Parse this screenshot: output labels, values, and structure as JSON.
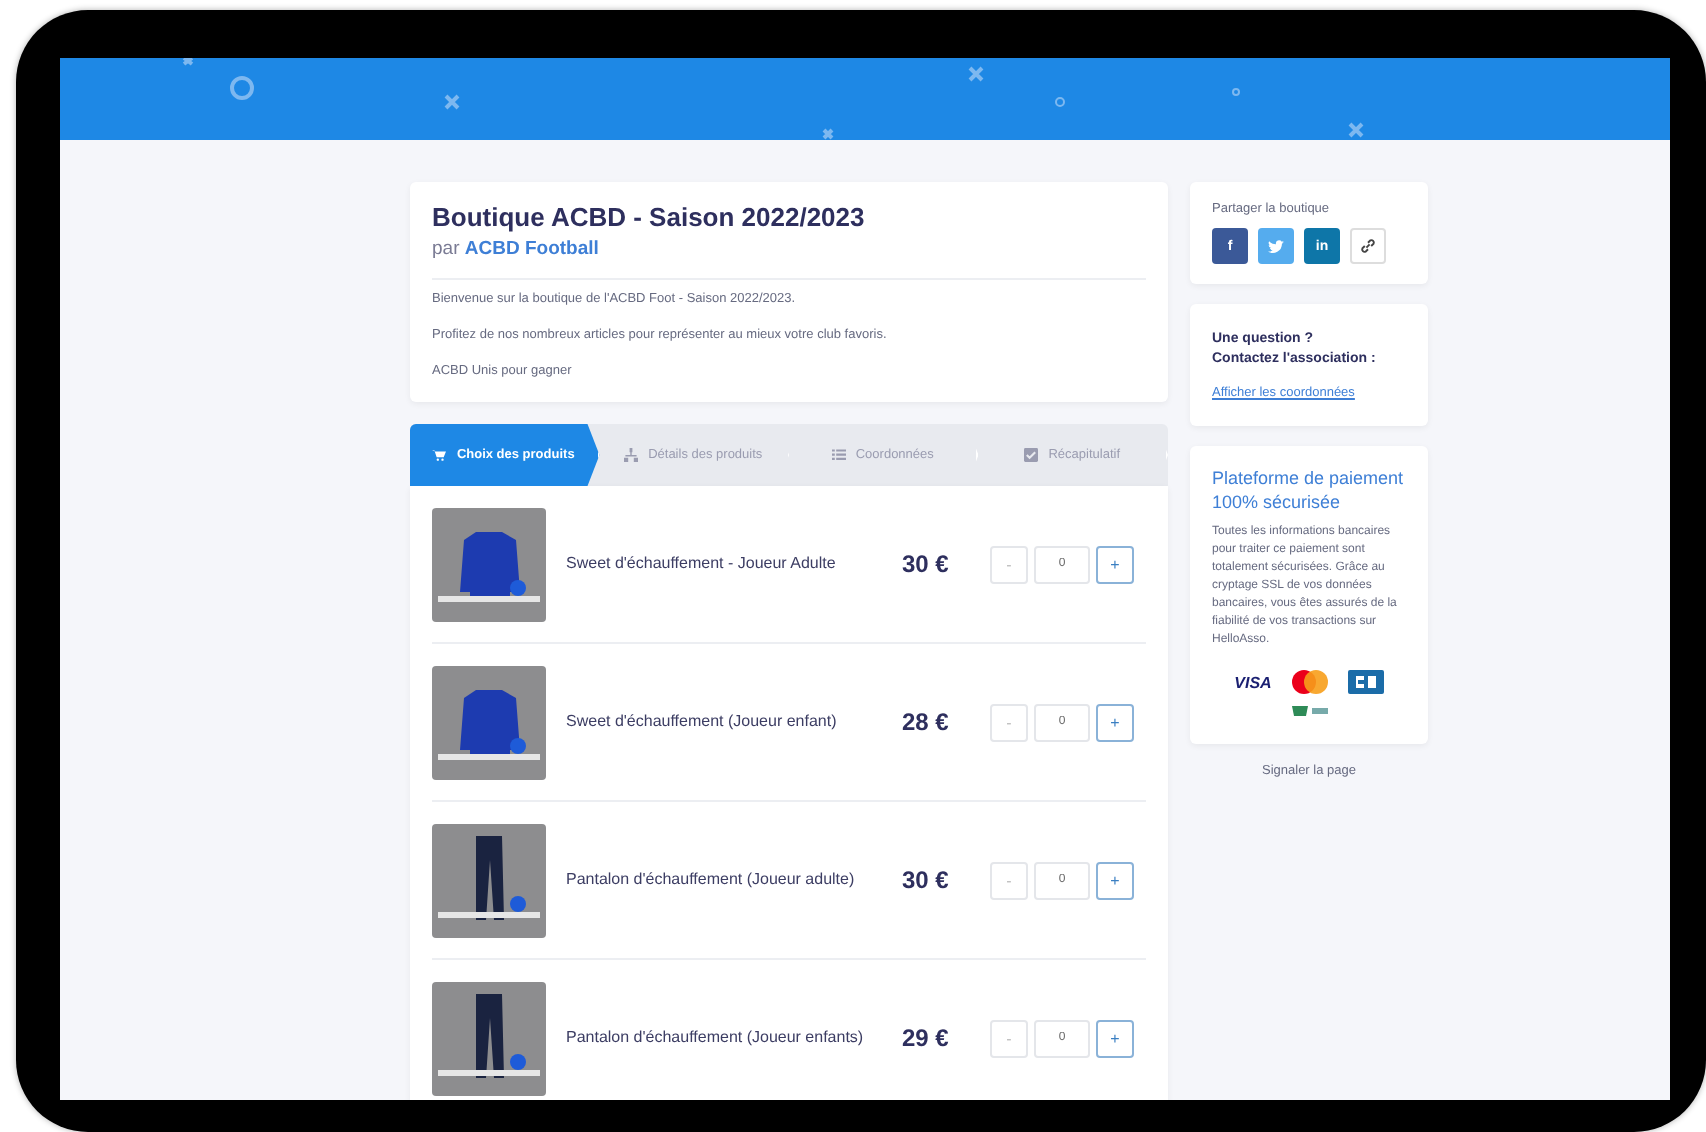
{
  "shop": {
    "title": "Boutique ACBD - Saison 2022/2023",
    "by_prefix": "par",
    "organizer": "ACBD Football",
    "paragraphs": [
      "Bienvenue sur la boutique de l'ACBD Foot - Saison 2022/2023.",
      "Profitez de nos nombreux articles pour représenter au mieux votre club favoris.",
      "ACBD Unis pour gagner"
    ]
  },
  "steps": [
    {
      "label": "Choix des produits",
      "selected": true
    },
    {
      "label": "Détails des produits",
      "selected": false
    },
    {
      "label": "Coordonnées",
      "selected": false
    },
    {
      "label": "Récapitulatif",
      "selected": false
    }
  ],
  "products": [
    {
      "name": "Sweet d'échauffement - Joueur Adulte",
      "price": "30 €",
      "quantity": "0",
      "minus": "-",
      "plus": "+",
      "minus_disabled": true
    },
    {
      "name": "Sweet d'échauffement (Joueur enfant)",
      "price": "28 €",
      "quantity": "0",
      "minus": "-",
      "plus": "+",
      "minus_disabled": true
    },
    {
      "name": "Pantalon d'échauffement (Joueur adulte)",
      "price": "30 €",
      "quantity": "0",
      "minus": "-",
      "plus": "+",
      "minus_disabled": true
    },
    {
      "name": "Pantalon d'échauffement (Joueur enfants)",
      "price": "29 €",
      "quantity": "0",
      "minus": "-",
      "plus": "+",
      "minus_disabled": true
    }
  ],
  "share": {
    "title": "Partager la boutique",
    "buttons": [
      {
        "kind": "facebook",
        "glyph": "f"
      },
      {
        "kind": "twitter"
      },
      {
        "kind": "linkedin",
        "glyph": "in"
      },
      {
        "kind": "link"
      }
    ]
  },
  "contact": {
    "question": "Une question ?",
    "prompt": "Contactez l'association :",
    "link": "Afficher les coordonnées"
  },
  "security": {
    "title": "Plateforme de paiement 100% sécurisée",
    "text": "Toutes les informations bancaires pour traiter ce paiement sont totalement sécurisées. Grâce au cryptage SSL de vos données bancaires, vous êtes assurés de la fiabilité de vos transactions sur HelloAsso.",
    "cards": [
      {
        "kind": "visa",
        "label": "VISA"
      },
      {
        "kind": "mastercard"
      },
      {
        "kind": "cb"
      },
      {
        "kind": "ssl"
      }
    ]
  },
  "report_link": "Signaler la page"
}
